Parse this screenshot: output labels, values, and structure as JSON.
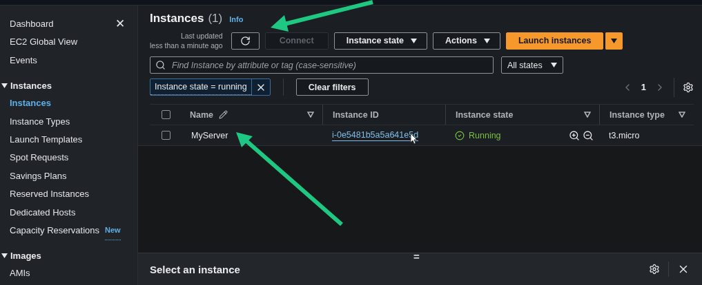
{
  "sidebar": {
    "close": "✕",
    "top_items": [
      {
        "label": "Dashboard",
        "selected": false
      },
      {
        "label": "EC2 Global View",
        "selected": false
      },
      {
        "label": "Events",
        "selected": false
      }
    ],
    "sections": [
      {
        "title": "Instances",
        "expanded": true,
        "items": [
          {
            "label": "Instances",
            "selected": true
          },
          {
            "label": "Instance Types",
            "selected": false
          },
          {
            "label": "Launch Templates",
            "selected": false
          },
          {
            "label": "Spot Requests",
            "selected": false
          },
          {
            "label": "Savings Plans",
            "selected": false
          },
          {
            "label": "Reserved Instances",
            "selected": false
          },
          {
            "label": "Dedicated Hosts",
            "selected": false
          },
          {
            "label": "Capacity Reservations",
            "selected": false,
            "badge": "New"
          }
        ]
      },
      {
        "title": "Images",
        "expanded": true,
        "items": [
          {
            "label": "AMIs",
            "selected": false
          }
        ]
      }
    ]
  },
  "header": {
    "title": "Instances",
    "count": "(1)",
    "info": "Info",
    "last_updated": [
      "Last updated",
      "less than a minute ago"
    ],
    "buttons": [
      {
        "kind": "refresh",
        "disabled": false
      },
      {
        "kind": "plain",
        "label": "Connect",
        "disabled": true
      },
      {
        "kind": "dropdown",
        "label": "Instance state",
        "disabled": false
      },
      {
        "kind": "dropdown",
        "label": "Actions",
        "disabled": false
      },
      {
        "kind": "primary",
        "label": "Launch instances",
        "disabled": false
      }
    ]
  },
  "search": {
    "placeholder": "Find Instance by attribute or tag (case-sensitive)",
    "state_filter": "All states"
  },
  "filters": {
    "tokens": [
      "Instance state = running"
    ],
    "clear": "Clear filters",
    "page": "1"
  },
  "table": {
    "select_all_checked": false,
    "columns": [
      {
        "label": "Name",
        "editable": true,
        "sortable": true
      },
      {
        "label": "Instance ID",
        "editable": false,
        "sortable": false
      },
      {
        "label": "Instance state",
        "editable": false,
        "sortable": true
      },
      {
        "label": "Instance type",
        "editable": false,
        "sortable": true
      }
    ],
    "rows": [
      {
        "checked": false,
        "name": "MyServer",
        "id": "i-0e5481b5a5a641e5d",
        "state": "Running",
        "kind": "running",
        "type": "t3.micro"
      }
    ]
  },
  "details": {
    "handle": "=",
    "title": "Select an instance"
  }
}
